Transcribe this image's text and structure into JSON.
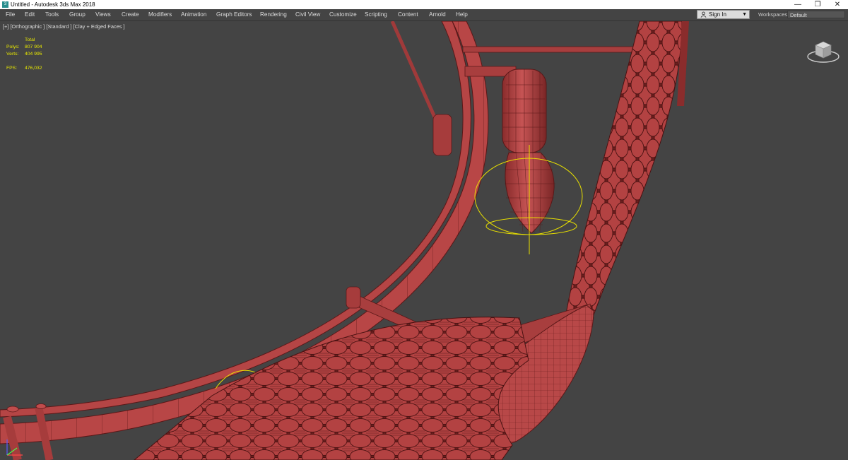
{
  "titlebar": {
    "title": "Untitled - Autodesk 3ds Max 2018",
    "app_icon_glyph": "3",
    "minimize_glyph": "—",
    "restore_glyph": "❐",
    "close_glyph": "✕"
  },
  "menubar": {
    "items": [
      "File",
      "Edit",
      "Tools",
      "Group",
      "Views",
      "Create",
      "Modifiers",
      "Animation",
      "Graph Editors",
      "Rendering",
      "Civil View",
      "Customize",
      "Scripting",
      "Content",
      "Arnold",
      "Help"
    ]
  },
  "account": {
    "signin_label": "Sign In",
    "caret": "▼"
  },
  "workspaces": {
    "label": "Workspaces:",
    "value": "Default"
  },
  "viewport": {
    "label": "[+] [Orthographic ] [Standard ] [Clay + Edged Faces ]",
    "background": "#444444"
  },
  "stats": {
    "header": "Total",
    "polys_label": "Polys:",
    "polys_value": "807 904",
    "verts_label": "Verts:",
    "verts_value": "404 995",
    "fps_label": "FPS:",
    "fps_value": "476,032",
    "color": "#e8e800"
  },
  "colors": {
    "clay": "#b54545",
    "clay_dark": "#7a2424",
    "wire": "#4a1212",
    "selection": "#e8e000"
  },
  "icons": [
    "user-icon",
    "viewcube-icon",
    "axis-tripod-icon",
    "caret-down-icon"
  ]
}
